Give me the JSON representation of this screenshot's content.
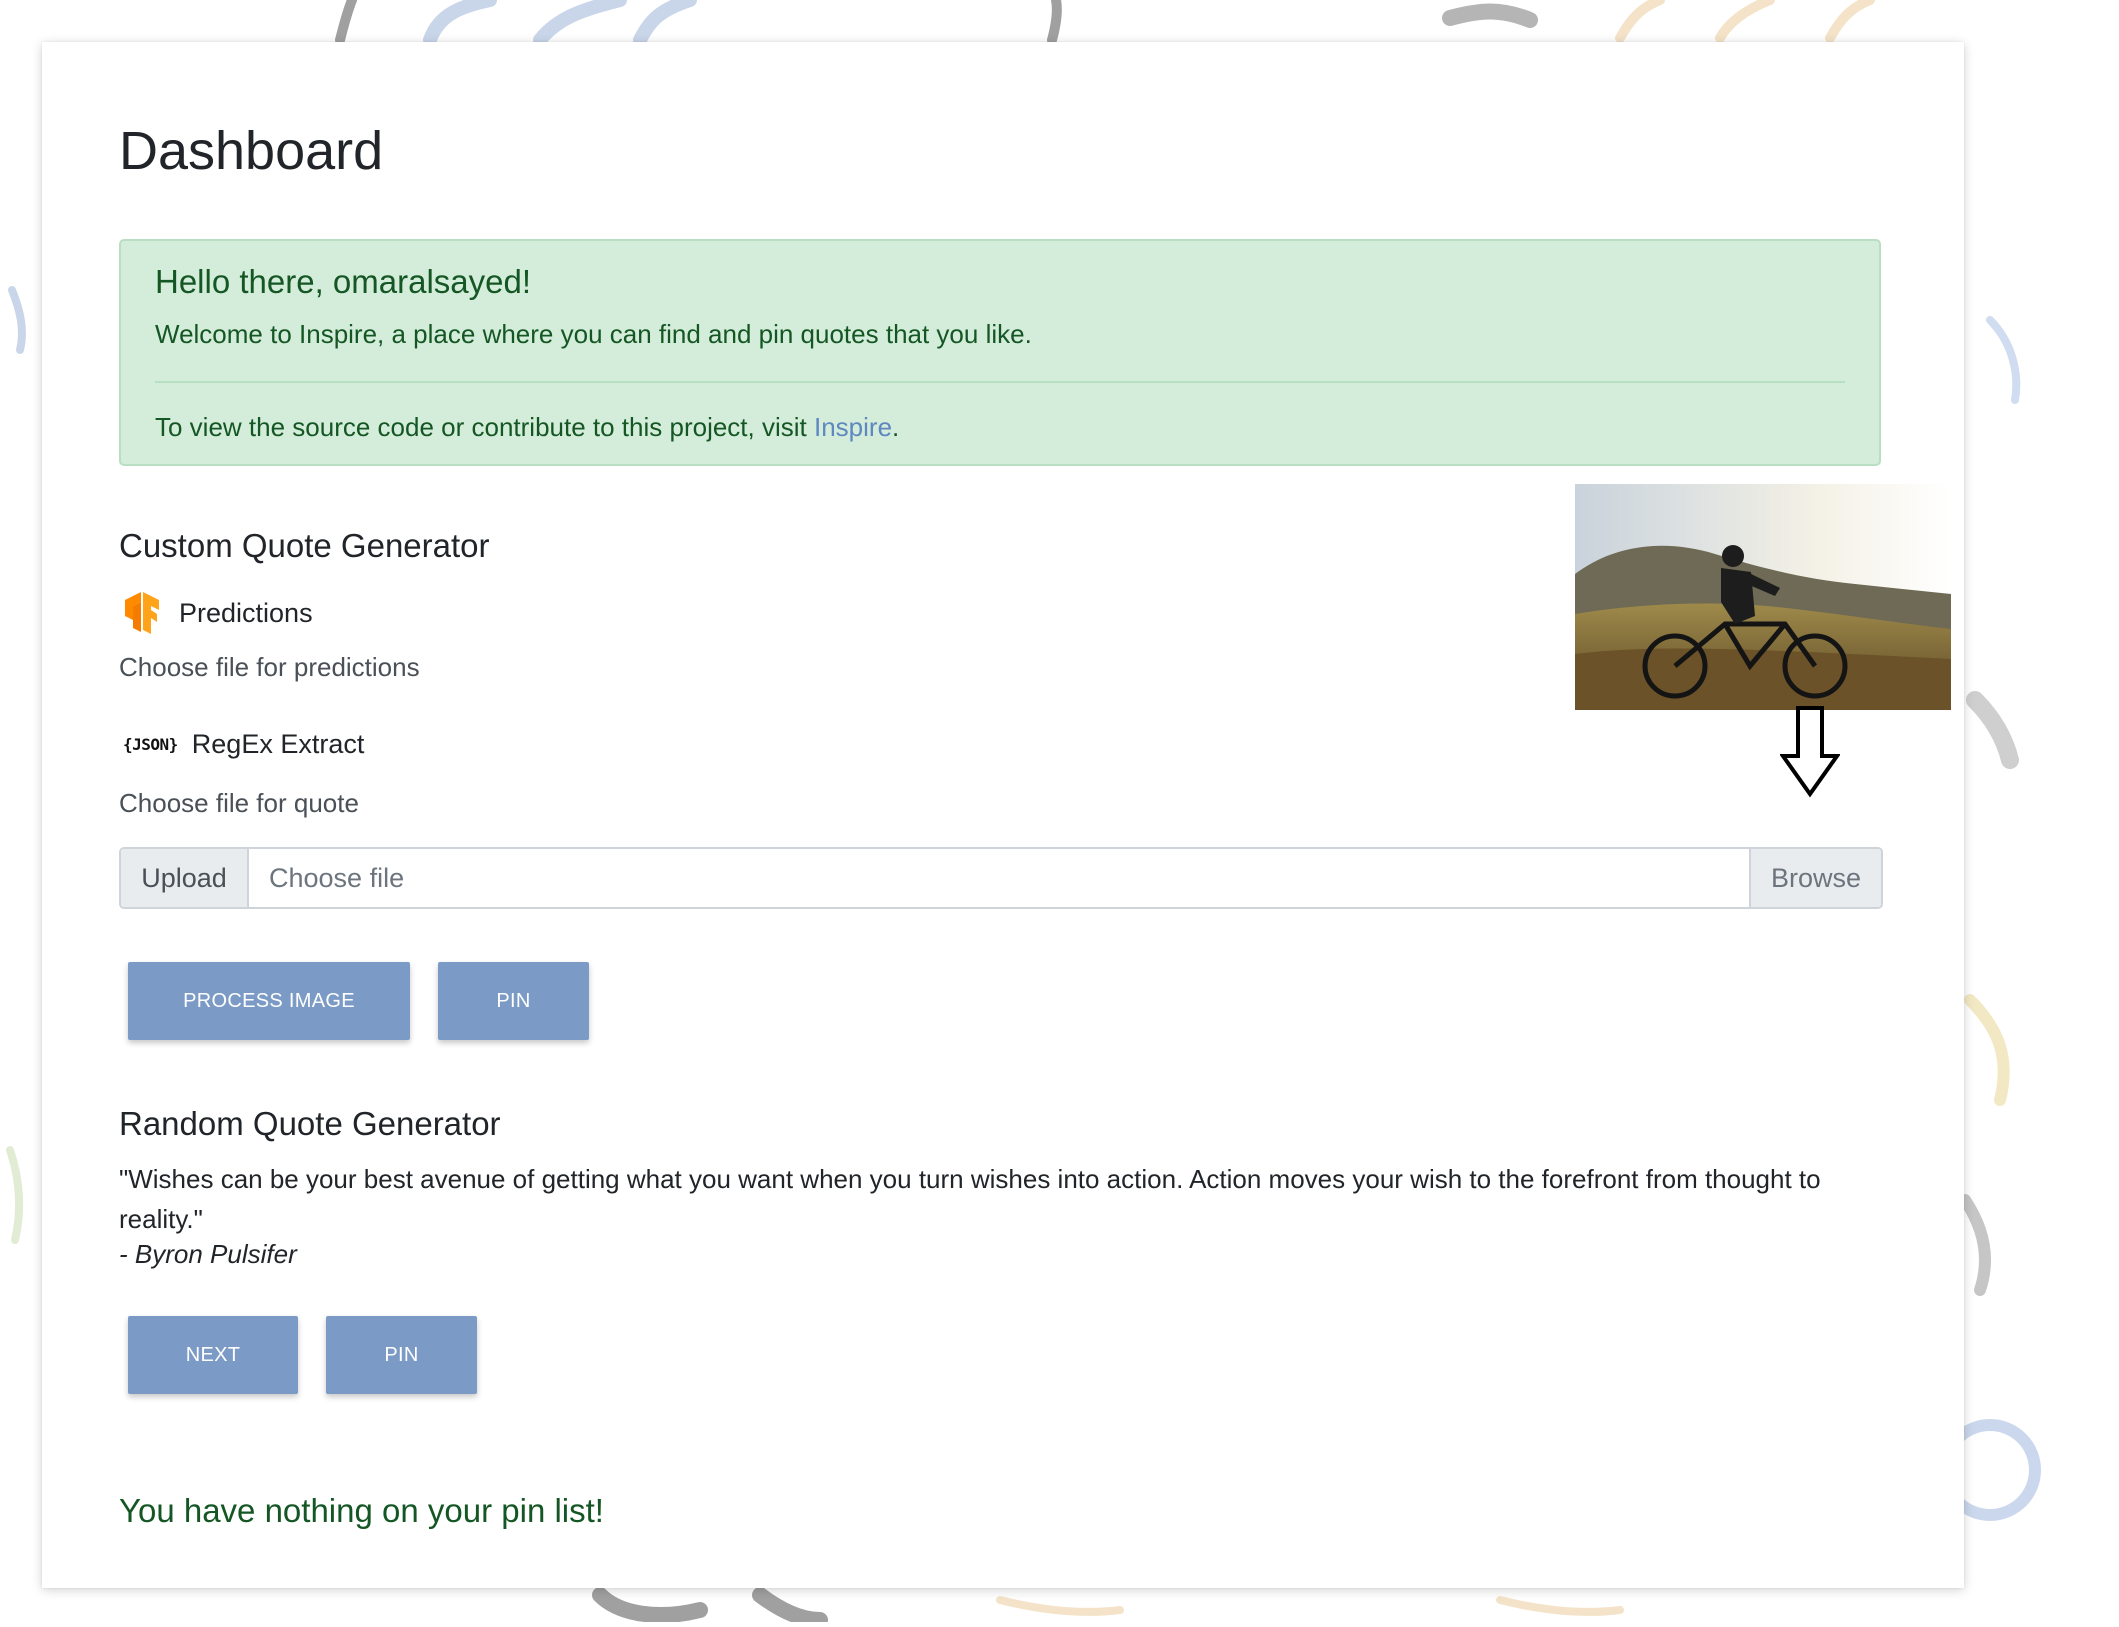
{
  "page": {
    "title": "Dashboard"
  },
  "alert": {
    "heading": "Hello there, omaralsayed!",
    "welcome": "Welcome to Inspire, a place where you can find and pin quotes that you like.",
    "source_prefix": "To view the source code or contribute to this project, visit ",
    "source_link": "Inspire",
    "source_suffix": "."
  },
  "custom_generator": {
    "title": "Custom Quote Generator",
    "predictions": {
      "icon": "tensorflow-icon",
      "label": "Predictions",
      "hint": "Choose file for predictions"
    },
    "regex": {
      "icon": "json-icon",
      "icon_text": "{JSON}",
      "label": "RegEx Extract",
      "hint": "Choose file for quote"
    },
    "upload": {
      "label": "Upload",
      "placeholder": "Choose file",
      "browse": "Browse"
    },
    "buttons": {
      "process": "PROCESS IMAGE",
      "pin": "PIN"
    }
  },
  "random_generator": {
    "title": "Random Quote Generator",
    "quote": "\"Wishes can be your best avenue of getting what you want when you turn wishes into action. Action moves your wish to the forefront from thought to reality.\"",
    "author": "- Byron Pulsifer",
    "buttons": {
      "next": "NEXT",
      "pin": "PIN"
    }
  },
  "pin_list": {
    "empty_message": "You have nothing on your pin list!"
  },
  "colors": {
    "alert_bg": "#d4edda",
    "alert_text": "#155724",
    "button_bg": "#7b9bc6",
    "link": "#5f87c0"
  }
}
